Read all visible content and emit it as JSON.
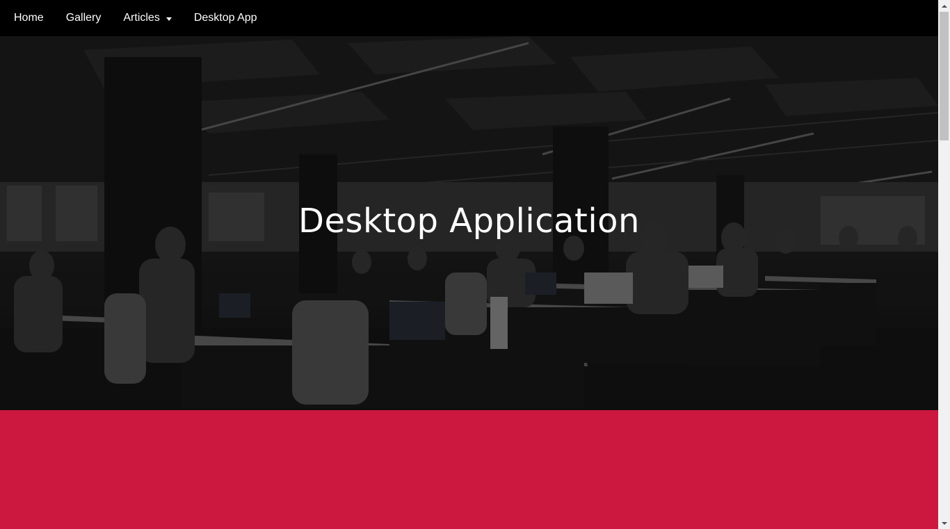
{
  "nav": {
    "items": [
      {
        "label": "Home"
      },
      {
        "label": "Gallery"
      },
      {
        "label": "Articles",
        "has_dropdown": true
      },
      {
        "label": "Desktop App"
      }
    ]
  },
  "hero": {
    "title": "Desktop Application",
    "image": "office-workspace-photo"
  },
  "colors": {
    "navbar": "#000000",
    "section_accent": "#cc173f",
    "text": "#ffffff"
  }
}
